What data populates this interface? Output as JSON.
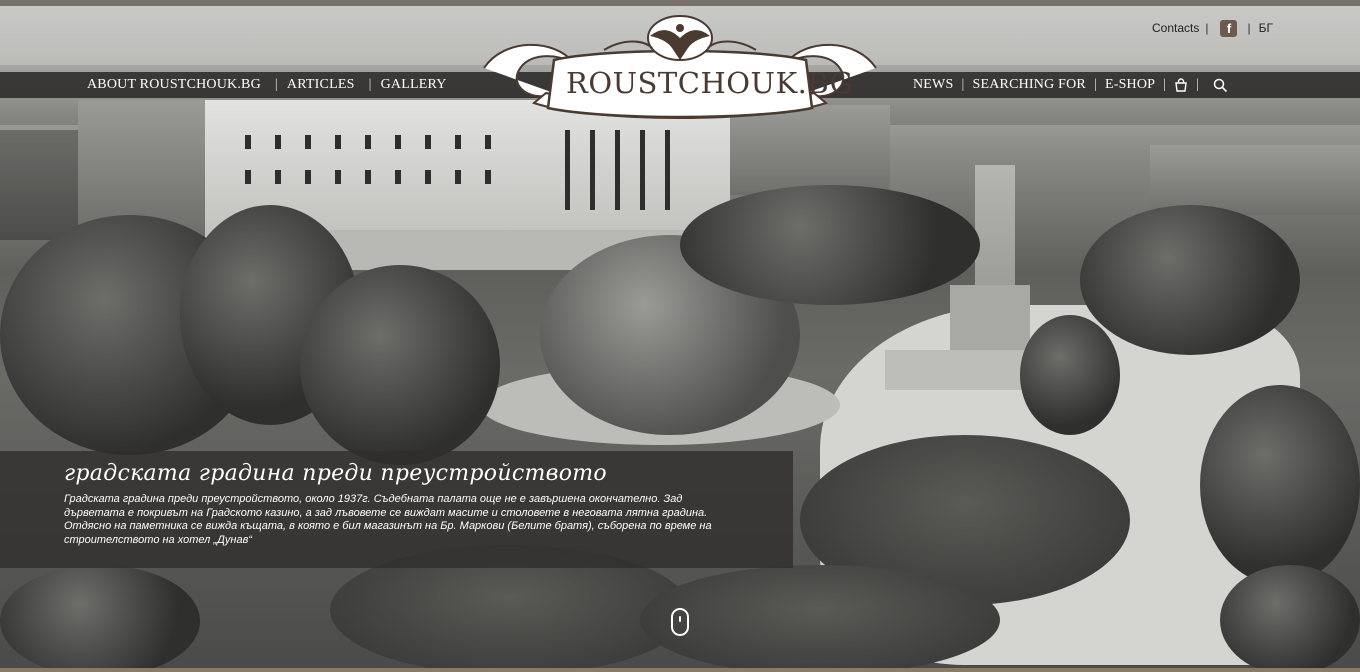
{
  "site": {
    "logo_text": "ROUSTCHOUK.BG"
  },
  "utility": {
    "contacts": "Contacts",
    "facebook_icon": "facebook-icon",
    "language": "БГ"
  },
  "nav": {
    "left": [
      "ABOUT ROUSTCHOUK.BG",
      "ARTICLES",
      "GALLERY"
    ],
    "right": [
      "NEWS",
      "SEARCHING FOR",
      "E-SHOP"
    ],
    "cart_icon": "shopping-bag-icon",
    "search_icon": "search-icon"
  },
  "caption": {
    "title": "градската градина преди преустройството",
    "text": "Градската градина преди преустройството, около 1937г. Съдебната палата още не е завършена окончателно. Зад дърветата е покривът на Градското казино, а зад лъвовете се виждат масите и столовете в неговата лятна градина. Отдясно на паметника се вижда къщата, в която е бил магазинът на Бр. Маркови (Белите братя), съборена по време на строителството на хотел „Дунав“"
  },
  "colors": {
    "navbar": "#2a2827",
    "accent_brown": "#6b5a4d",
    "caption_bg": "#302e2d"
  }
}
